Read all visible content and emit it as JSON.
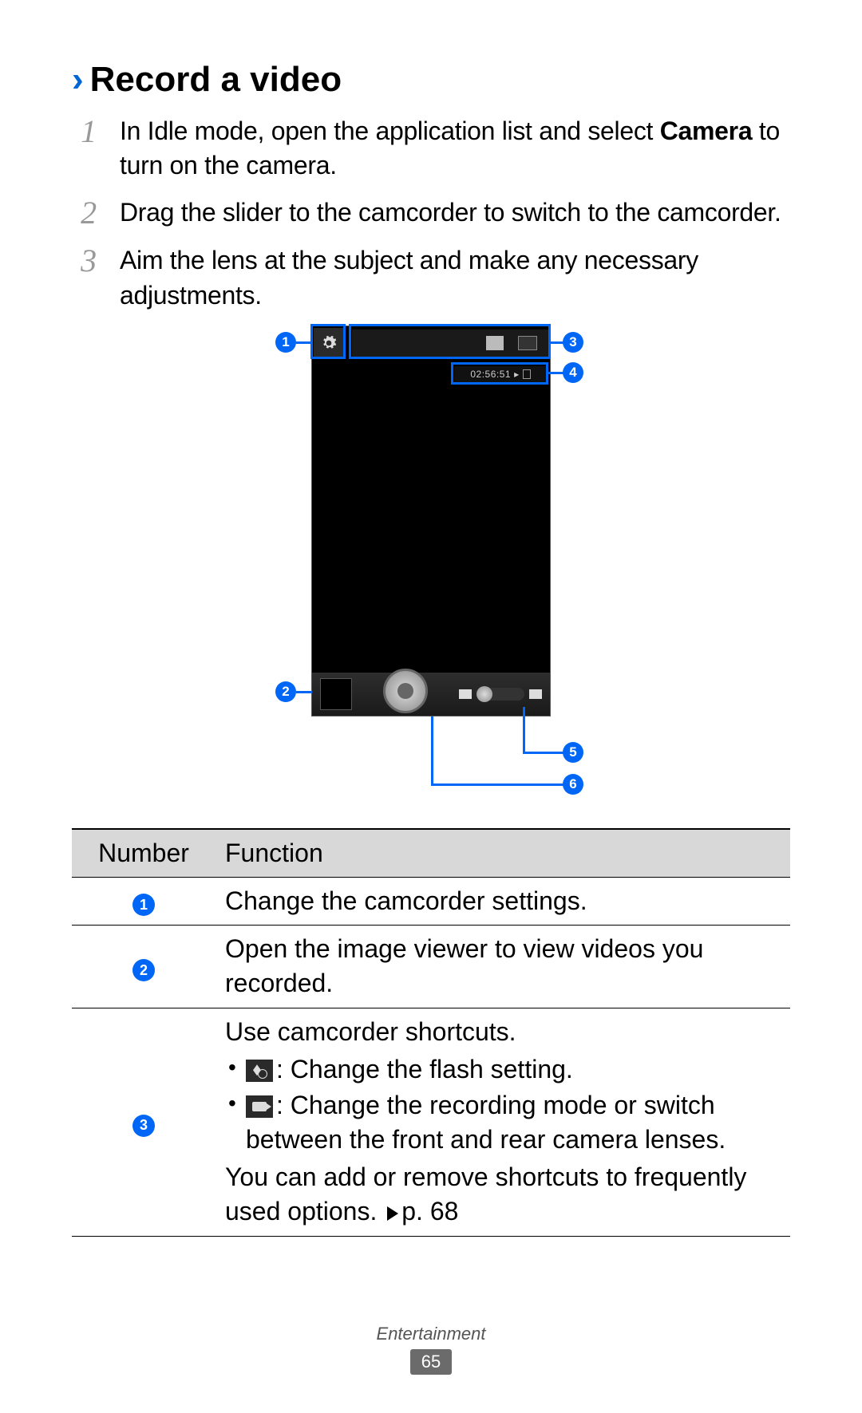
{
  "heading": {
    "chevron": "›",
    "title": "Record a video"
  },
  "steps": [
    {
      "num": "1",
      "pre": "In Idle mode, open the application list and select ",
      "bold": "Camera",
      "post": " to turn on the camera."
    },
    {
      "num": "2",
      "pre": "Drag the slider to the camcorder to switch to the camcorder.",
      "bold": "",
      "post": ""
    },
    {
      "num": "3",
      "pre": "Aim the lens at the subject and make any necessary adjustments.",
      "bold": "",
      "post": ""
    }
  ],
  "figure": {
    "timer": "02:56:51",
    "callouts": {
      "c1": "1",
      "c2": "2",
      "c3": "3",
      "c4": "4",
      "c5": "5",
      "c6": "6"
    }
  },
  "table": {
    "headers": {
      "number": "Number",
      "function": "Function"
    },
    "rows": [
      {
        "num": "1",
        "func_plain": "Change the camcorder settings."
      },
      {
        "num": "2",
        "func_plain": "Open the image viewer to view videos you recorded."
      },
      {
        "num": "3",
        "intro": "Use camcorder shortcuts.",
        "bullets": [
          {
            "icon": "flash-off-icon",
            "text": ": Change the flash setting."
          },
          {
            "icon": "camcorder-mode-icon",
            "text": ": Change the recording mode or switch between the front and rear camera lenses."
          }
        ],
        "outro_pre": "You can add or remove shortcuts to frequently used options. ",
        "outro_ref": "p. 68"
      }
    ]
  },
  "footer": {
    "section": "Entertainment",
    "page": "65"
  }
}
